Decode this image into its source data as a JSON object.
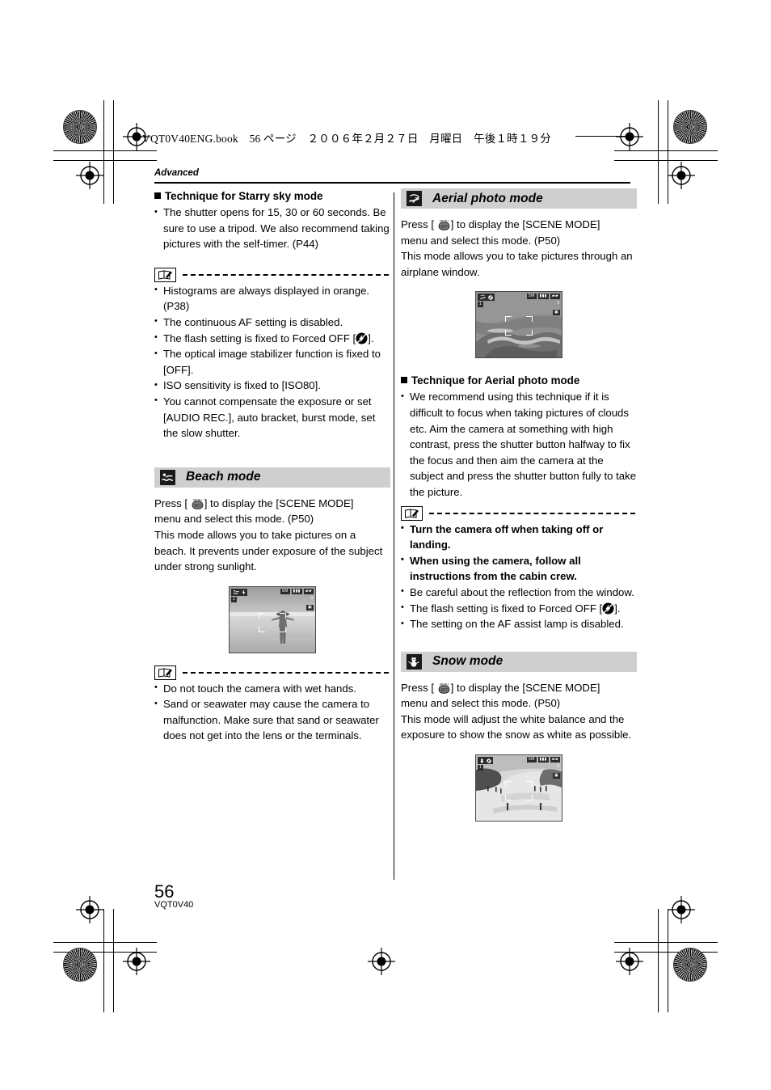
{
  "page": {
    "file_header": "VQT0V40ENG.book　56 ページ　２００６年２月２７日　月曜日　午後１時１９分",
    "running_head": "Advanced",
    "folio": "56",
    "folio_code": "VQT0V40"
  },
  "left_column": {
    "starry": {
      "heading": "Technique for Starry sky mode",
      "bullets": [
        "The shutter opens for 15, 30 or 60 seconds. Be sure to use a tripod. We also recommend taking pictures with the self-timer. (P44)"
      ],
      "note_bullets": [
        "Histograms are always displayed in orange. (P38)",
        "The continuous AF setting is disabled.",
        "The optical image stabilizer function is fixed to [OFF].",
        "ISO sensitivity is fixed to [ISO80].",
        "You cannot compensate the exposure or set [AUDIO REC.], auto bracket, burst mode, set the slow shutter."
      ],
      "flash_bullet_prefix": "The flash setting is fixed to Forced OFF",
      "flash_bullet_suffix": "."
    },
    "beach": {
      "icon": "swimmer-icon",
      "title": "Beach mode",
      "press_prefix": "Press [",
      "press_suffix": "] to display the [SCENE MODE]",
      "body_line2": "menu and select this mode. (P50)",
      "body_line3": "This mode allows you to take pictures on a beach. It prevents under exposure of the subject under strong sunlight.",
      "note_bullets": [
        "Do not touch the camera with wet hands.",
        "Sand or seawater may cause the camera to malfunction. Make sure that sand or seawater does not get into the lens or the terminals."
      ],
      "shot": {
        "alt": "beach-scene-thumbnail",
        "counter": "3",
        "flash_value": "1"
      }
    }
  },
  "right_column": {
    "aerial": {
      "icon": "airplane-icon",
      "title": "Aerial photo mode",
      "press_prefix": "Press [",
      "press_suffix": "] to display the [SCENE MODE]",
      "body_line2": "menu and select this mode. (P50)",
      "body_line3": "This mode allows you to take pictures through an airplane window.",
      "shot": {
        "alt": "aerial-coastline-thumbnail",
        "counter": "3",
        "flash_value": "1"
      },
      "technique_heading": "Technique for Aerial photo mode",
      "technique_bullets": [
        "We recommend using this technique if it is difficult to focus when taking pictures of clouds etc. Aim the camera at something with high contrast, press the shutter button halfway to fix the focus and then aim the camera at the subject and press the shutter button fully to take the picture."
      ],
      "note_bullets_bold": [
        "Turn the camera off when taking off or landing.",
        "When using the camera, follow all instructions from the cabin crew."
      ],
      "note_bullets_plain": [
        "Be careful about the reflection from the window."
      ],
      "flash_bullet_prefix": "The flash setting is fixed to Forced OFF",
      "flash_bullet_suffix": ".",
      "note_bullets_tail": [
        "The setting on the AF assist lamp is disabled."
      ]
    },
    "snow": {
      "icon": "snowman-icon",
      "title": "Snow mode",
      "press_prefix": "Press [",
      "press_suffix": "] to display the [SCENE MODE]",
      "body_line2": "menu and select this mode. (P50)",
      "body_line3": "This mode will adjust the white balance and the exposure to show the snow as white as possible.",
      "shot": {
        "alt": "ski-slope-thumbnail",
        "counter": "3",
        "flash_value": "1"
      }
    }
  },
  "icons": {
    "menu_set_top": "MENU",
    "menu_set_bottom": "SET",
    "memo": "memo-icon",
    "flash_off": "flash-off-icon"
  },
  "colors": {
    "mode_bar_bg": "#cfcfcf",
    "mode_icon_bg": "#1a1a1a",
    "text": "#000000"
  }
}
